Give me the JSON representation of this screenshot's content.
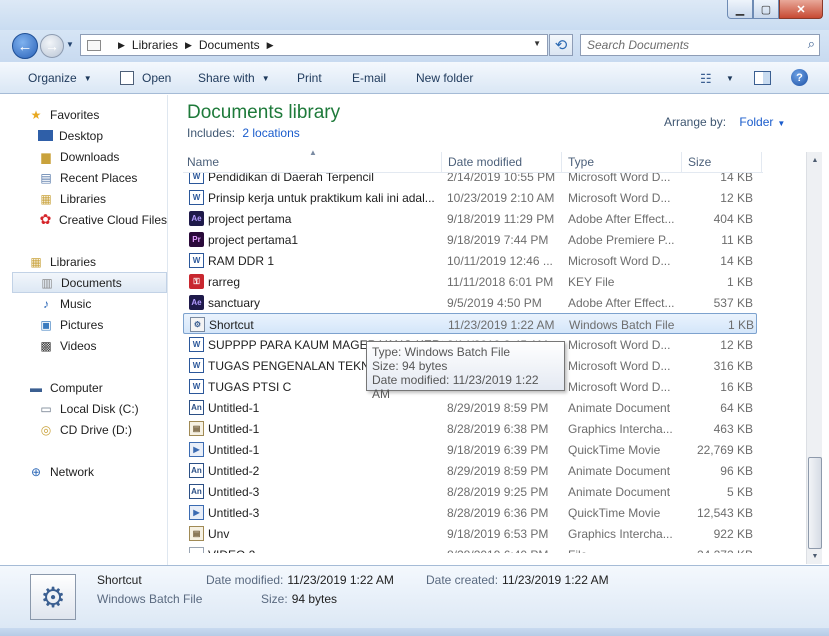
{
  "address": {
    "crumbs": [
      "Libraries",
      "Documents"
    ]
  },
  "search": {
    "placeholder": "Search Documents"
  },
  "toolbar": {
    "organize": "Organize",
    "open": "Open",
    "share_with": "Share with",
    "print": "Print",
    "email": "E-mail",
    "new_folder": "New folder"
  },
  "nav": {
    "favorites": "Favorites",
    "desktop": "Desktop",
    "downloads": "Downloads",
    "recent_places": "Recent Places",
    "libraries_fav": "Libraries",
    "creative_cloud": "Creative Cloud Files",
    "libraries": "Libraries",
    "documents": "Documents",
    "music": "Music",
    "pictures": "Pictures",
    "videos": "Videos",
    "computer": "Computer",
    "local_disk": "Local Disk (C:)",
    "cd_drive": "CD Drive (D:)",
    "network": "Network"
  },
  "library": {
    "title": "Documents library",
    "includes_label": "Includes:",
    "includes_link": "2 locations",
    "arrange_label": "Arrange by:",
    "arrange_value": "Folder"
  },
  "columns": {
    "name": "Name",
    "date": "Date modified",
    "type": "Type",
    "size": "Size"
  },
  "files": [
    {
      "name": "Pendidikan di Daerah Terpencil",
      "date": "2/14/2019 10:55 PM",
      "type": "Microsoft Word D...",
      "size": "14 KB",
      "icon": "word"
    },
    {
      "name": "Prinsip kerja untuk praktikum kali ini adal...",
      "date": "10/23/2019 2:10 AM",
      "type": "Microsoft Word D...",
      "size": "12 KB",
      "icon": "word"
    },
    {
      "name": "project pertama",
      "date": "9/18/2019 11:29 PM",
      "type": "Adobe After Effect...",
      "size": "404 KB",
      "icon": "ae"
    },
    {
      "name": "project pertama1",
      "date": "9/18/2019 7:44 PM",
      "type": "Adobe Premiere P...",
      "size": "11 KB",
      "icon": "pr"
    },
    {
      "name": "RAM DDR 1",
      "date": "10/11/2019 12:46 ...",
      "type": "Microsoft Word D...",
      "size": "14 KB",
      "icon": "word"
    },
    {
      "name": "rarreg",
      "date": "11/11/2018 6:01 PM",
      "type": "KEY File",
      "size": "1 KB",
      "icon": "key"
    },
    {
      "name": "sanctuary",
      "date": "9/5/2019 4:50 PM",
      "type": "Adobe After Effect...",
      "size": "537 KB",
      "icon": "ae"
    },
    {
      "name": "Shortcut",
      "date": "11/23/2019 1:22 AM",
      "type": "Windows Batch File",
      "size": "1 KB",
      "icon": "bat",
      "selected": true
    },
    {
      "name": "SUPPPP PARA KAUM MAGER YANG KERJ...",
      "date": "8/14/2019 8:45 AM",
      "type": "Microsoft Word D...",
      "size": "12 KB",
      "icon": "word"
    },
    {
      "name": "TUGAS PENGENALAN TEKNIK...",
      "date": "10/23/2019 2:10 AM",
      "type": "Microsoft Word D...",
      "size": "316 KB",
      "icon": "word"
    },
    {
      "name": "TUGAS PTSI C",
      "date": "10/23/2019 2:10 AM",
      "type": "Microsoft Word D...",
      "size": "16 KB",
      "icon": "word"
    },
    {
      "name": "Untitled-1",
      "date": "8/29/2019 8:59 PM",
      "type": "Animate Document",
      "size": "64 KB",
      "icon": "an"
    },
    {
      "name": "Untitled-1",
      "date": "8/28/2019 6:38 PM",
      "type": "Graphics Intercha...",
      "size": "463 KB",
      "icon": "gfx"
    },
    {
      "name": "Untitled-1",
      "date": "9/18/2019 6:39 PM",
      "type": "QuickTime Movie",
      "size": "22,769 KB",
      "icon": "qt"
    },
    {
      "name": "Untitled-2",
      "date": "8/29/2019 8:59 PM",
      "type": "Animate Document",
      "size": "96 KB",
      "icon": "an"
    },
    {
      "name": "Untitled-3",
      "date": "8/28/2019 9:25 PM",
      "type": "Animate Document",
      "size": "5 KB",
      "icon": "an"
    },
    {
      "name": "Untitled-3",
      "date": "8/28/2019 6:36 PM",
      "type": "QuickTime Movie",
      "size": "12,543 KB",
      "icon": "qt"
    },
    {
      "name": "Unv",
      "date": "9/18/2019 6:53 PM",
      "type": "Graphics Intercha...",
      "size": "922 KB",
      "icon": "gfx"
    },
    {
      "name": "VIDEO 2",
      "date": "8/28/2019 6:40 PM",
      "type": "File",
      "size": "24,272 KB",
      "icon": "blank"
    }
  ],
  "tooltip": {
    "type": "Type: Windows Batch File",
    "size": "Size: 94 bytes",
    "date": "Date modified: 11/23/2019 1:22 AM"
  },
  "details": {
    "name": "Shortcut",
    "type": "Windows Batch File",
    "date_modified_label": "Date modified:",
    "date_modified": "11/23/2019 1:22 AM",
    "date_created_label": "Date created:",
    "date_created": "11/23/2019 1:22 AM",
    "size_label": "Size:",
    "size": "94 bytes"
  }
}
